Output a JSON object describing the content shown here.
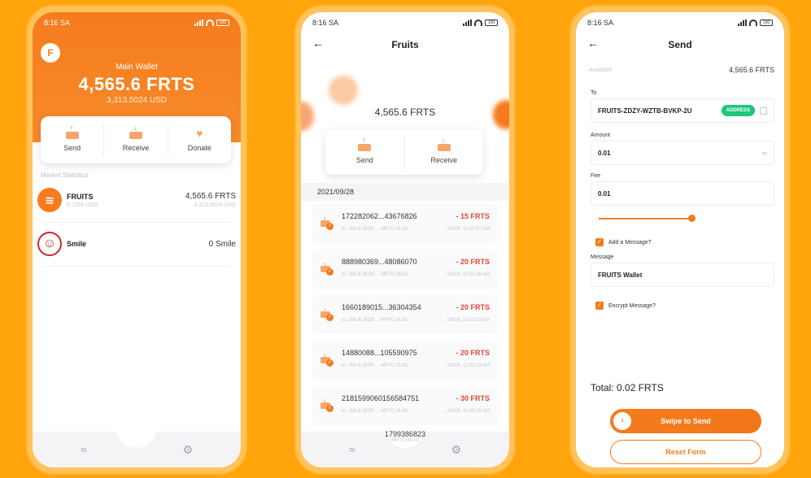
{
  "status": {
    "time": "8:16 SA",
    "battery": "100"
  },
  "screen1": {
    "logo": "F",
    "wallet_label": "Main Wallet",
    "wallet_amount": "4,565.6 FRTS",
    "wallet_usd": "3,313.5024 USD",
    "actions": {
      "send": "Send",
      "receive": "Receive",
      "donate": "Donate"
    },
    "section_title": "Market Statistics",
    "assets": [
      {
        "name": "FRUITS",
        "usd": "0.7258 USD",
        "value": "4,565.6 FRTS",
        "value_usd": "3,313.5024 USD",
        "icon": "fruits-logo"
      },
      {
        "name": "Smile",
        "value": "0 Smile",
        "icon": "smile-face"
      }
    ]
  },
  "screen2": {
    "title": "Fruits",
    "amount": "4,565.6 FRTS",
    "actions": {
      "send": "Send",
      "receive": "Receive"
    },
    "date": "2021/09/28",
    "transactions": [
      {
        "id": "172282062...43676826",
        "amount": "- 15 FRTS",
        "to": "to: 2ML9-2EDF... -MP7C-5UJU",
        "time": "...09/28, 11:52:57 AM"
      },
      {
        "id": "888980369...48086070",
        "amount": "- 20 FRTS",
        "to": "to: 2ML9-2EDF... -MP7C-5UJU",
        "time": "...09/28, 11:52:48 AM"
      },
      {
        "id": "1660189015...36304354",
        "amount": "- 20 FRTS",
        "to": "to: 2ML9-2EDF... -MP7C-5UJU",
        "time": "...09/28, 11:52:32 AM"
      },
      {
        "id": "14880088...105590975",
        "amount": "- 20 FRTS",
        "to": "to: 2ML9-2EDF... -MP7C-5UJU",
        "time": "...09/28, 11:52:19 AM"
      },
      {
        "id": "2181599060156584751",
        "amount": "- 30 FRTS",
        "to": "to: 2ML9-2EDF... -MP7C-5UJU",
        "time": "...09/28, 11:49:25 AM"
      }
    ],
    "partial_tx": {
      "id": "1799386823",
      "to": "MP7C-5UJU"
    }
  },
  "screen3": {
    "title": "Send",
    "available_label": "Available",
    "available_value": "4,565.6 FRTS",
    "to_label": "To",
    "to_value": "FRUITS-ZDZY-WZTB-BVKP-2U",
    "address_button": "ADDRESS",
    "amount_label": "Amount",
    "amount_value": "0.01",
    "fee_label": "Fee",
    "fee_value": "0.01",
    "fee_slider": 0.8,
    "add_message_label": "Add a Message?",
    "message_label": "Message",
    "message_value": "FRUITS Wallet",
    "encrypt_label": "Encrypt Message?",
    "total": "Total: 0.02 FRTS",
    "swipe_label": "Swipe to Send",
    "reset_label": "Reset Form"
  },
  "colors": {
    "accent": "#F57C1E",
    "background": "#FFA40A",
    "negative": "#E2463A",
    "address_green": "#1DC77B"
  }
}
